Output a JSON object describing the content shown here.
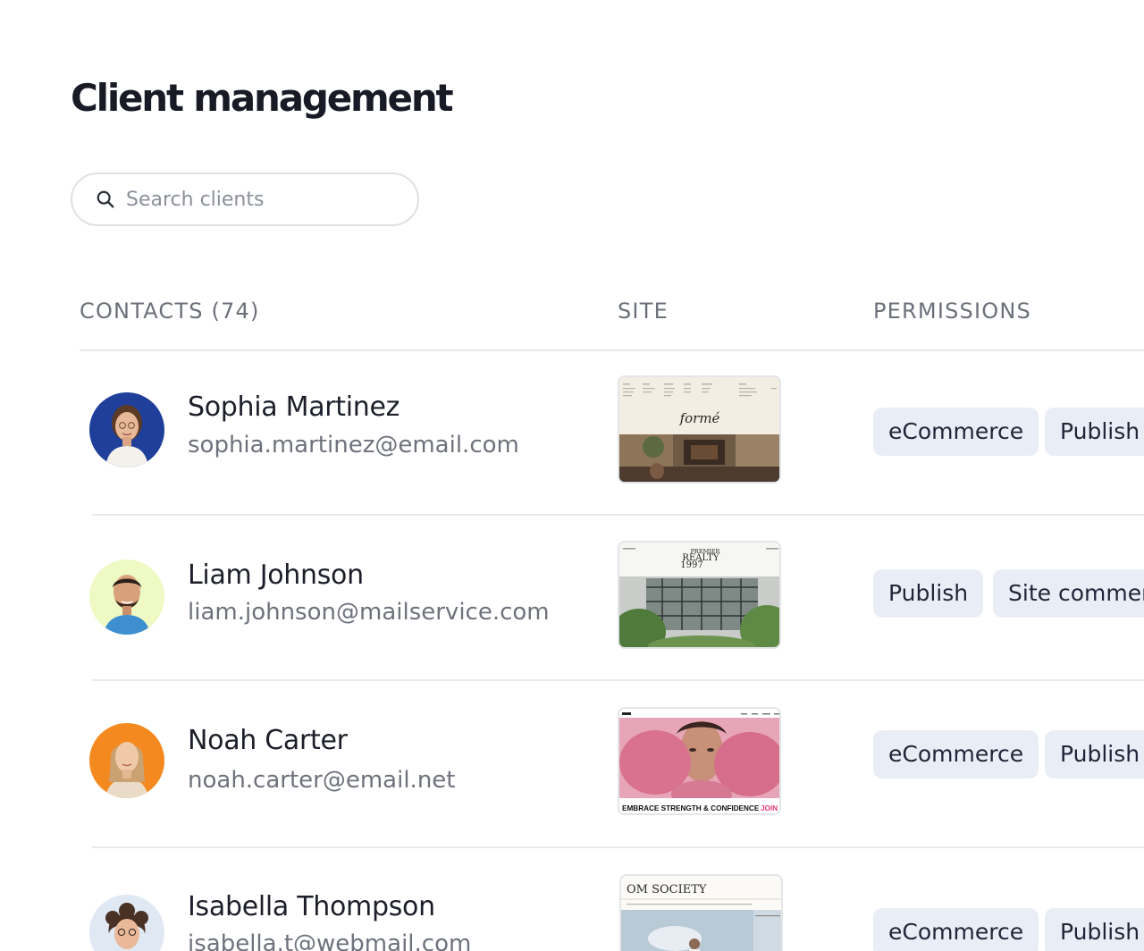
{
  "page": {
    "title": "Client management"
  },
  "search": {
    "placeholder": "Search clients",
    "icon": "search-icon"
  },
  "table": {
    "headers": {
      "contacts": "CONTACTS (74)",
      "site": "SITE",
      "permissions": "PERMISSIONS"
    },
    "rows": [
      {
        "name": "Sophia Martinez",
        "email": "sophia.martinez@email.com",
        "avatar_bg": "#1f3f9a",
        "site": {
          "brand": "formé"
        },
        "permissions": [
          "eCommerce",
          "Publish"
        ]
      },
      {
        "name": "Liam Johnson",
        "email": "liam.johnson@mailservice.com",
        "avatar_bg": "#eef9c4",
        "site": {
          "brand_lines": [
            "PREMIER",
            "REALTY",
            "1997"
          ]
        },
        "permissions": [
          "Publish",
          "Site comments"
        ]
      },
      {
        "name": "Noah Carter",
        "email": "noah.carter@email.net",
        "avatar_bg": "#f48a1f",
        "site": {
          "caption": "EMBRACE STRENGTH & CONFIDENCE",
          "cta": "JOIN NOW"
        },
        "permissions": [
          "eCommerce",
          "Publish"
        ]
      },
      {
        "name": "Isabella Thompson",
        "email": "isabella.t@webmail.com",
        "avatar_bg": "#dfe8f3",
        "site": {
          "brand": "OM SOCIETY"
        },
        "permissions": [
          "eCommerce",
          "Publish"
        ]
      }
    ]
  },
  "colors": {
    "chip_bg": "#e9eef6",
    "divider": "#e8e9ec",
    "muted_text": "#6e727c"
  }
}
